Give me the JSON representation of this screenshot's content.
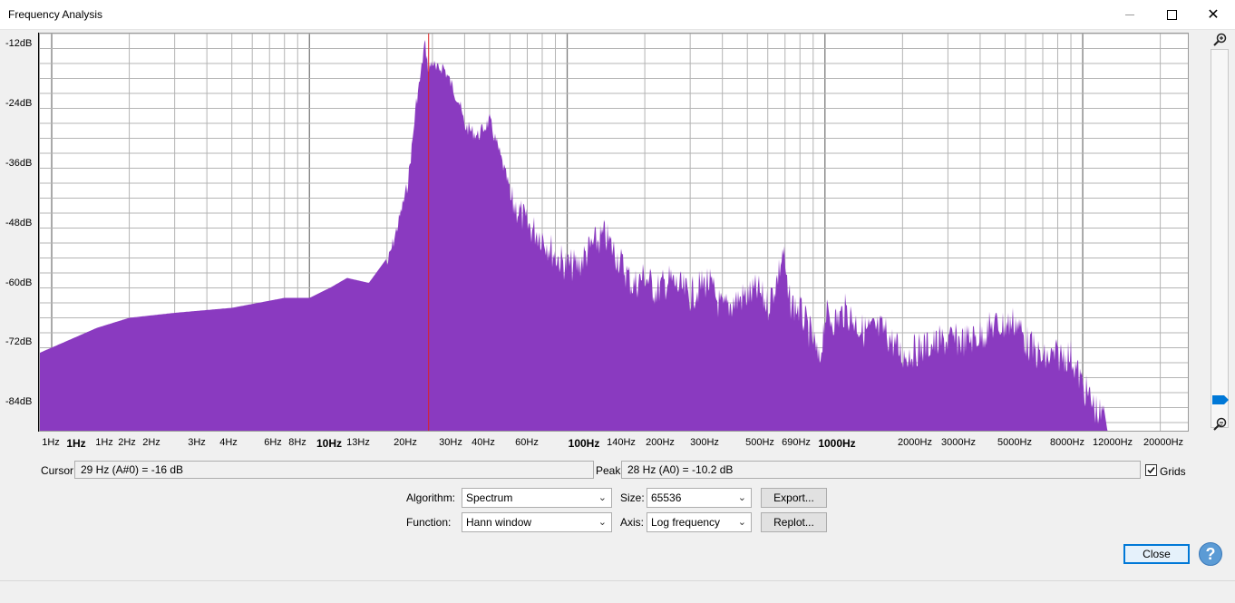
{
  "window": {
    "title": "Frequency Analysis",
    "minimize_glyph": "—",
    "close_glyph": "✕"
  },
  "graph": {
    "y_labels": [
      "-12dB",
      "-24dB",
      "-36dB",
      "-48dB",
      "-60dB",
      "-72dB",
      "-84dB"
    ],
    "x_labels": [
      {
        "text": "1Hz",
        "bold": false
      },
      {
        "text": "1Hz",
        "bold": true
      },
      {
        "text": "1Hz",
        "bold": false
      },
      {
        "text": "2Hz",
        "bold": false
      },
      {
        "text": "2Hz",
        "bold": false
      },
      {
        "text": "3Hz",
        "bold": false
      },
      {
        "text": "4Hz",
        "bold": false
      },
      {
        "text": "6Hz",
        "bold": false
      },
      {
        "text": "8Hz",
        "bold": false
      },
      {
        "text": "10Hz",
        "bold": true
      },
      {
        "text": "13Hz",
        "bold": false
      },
      {
        "text": "20Hz",
        "bold": false
      },
      {
        "text": "30Hz",
        "bold": false
      },
      {
        "text": "40Hz",
        "bold": false
      },
      {
        "text": "60Hz",
        "bold": false
      },
      {
        "text": "100Hz",
        "bold": true
      },
      {
        "text": "140Hz",
        "bold": false
      },
      {
        "text": "200Hz",
        "bold": false
      },
      {
        "text": "300Hz",
        "bold": false
      },
      {
        "text": "500Hz",
        "bold": false
      },
      {
        "text": "690Hz",
        "bold": false
      },
      {
        "text": "1000Hz",
        "bold": true
      },
      {
        "text": "2000Hz",
        "bold": false
      },
      {
        "text": "3000Hz",
        "bold": false
      },
      {
        "text": "5000Hz",
        "bold": false
      },
      {
        "text": "8000Hz",
        "bold": false
      },
      {
        "text": "12000Hz",
        "bold": false
      },
      {
        "text": "20000Hz",
        "bold": false
      }
    ],
    "fill_color": "#8a3ac0",
    "cursor_color": "#e02020",
    "grid_color": "#b4b4b4"
  },
  "chart_data": {
    "type": "area",
    "x_scale": "log",
    "x_unit": "Hz",
    "y_unit": "dB",
    "ylim": [
      -90,
      -10
    ],
    "xlim": [
      0.9,
      26000
    ],
    "grid": true,
    "cursor_hz": 29,
    "x": [
      0.9,
      1.5,
      2,
      3,
      5,
      8,
      10,
      12,
      14,
      17,
      20,
      22,
      24,
      25,
      26,
      27,
      28,
      29,
      30,
      31,
      33,
      35,
      38,
      40,
      45,
      50,
      55,
      60,
      65,
      70,
      80,
      90,
      100,
      110,
      125,
      140,
      160,
      180,
      200,
      220,
      250,
      300,
      350,
      400,
      450,
      500,
      550,
      600,
      650,
      690,
      720,
      800,
      900,
      950,
      1000,
      1100,
      1200,
      1400,
      1700,
      2000,
      2500,
      3000,
      3500,
      4000,
      4500,
      5000,
      5500,
      6000,
      7000,
      8000,
      9000,
      10000,
      11000,
      12000,
      12500,
      26000
    ],
    "y": [
      -74,
      -69,
      -67,
      -66,
      -65,
      -63,
      -63,
      -61,
      -59,
      -60,
      -55,
      -47,
      -39,
      -31,
      -22,
      -17,
      -10.2,
      -16,
      -14,
      -16,
      -15,
      -18,
      -22,
      -27,
      -29,
      -26,
      -33,
      -40,
      -42,
      -45,
      -47,
      -51,
      -53,
      -53,
      -49,
      -47,
      -52,
      -57,
      -55,
      -58,
      -56,
      -59,
      -56,
      -62,
      -60,
      -59,
      -58,
      -61,
      -56,
      -50,
      -60,
      -62,
      -68,
      -73,
      -63,
      -64,
      -62,
      -66,
      -66,
      -71,
      -69,
      -68,
      -68,
      -67,
      -65,
      -65,
      -64,
      -68,
      -72,
      -71,
      -71,
      -77,
      -81,
      -84,
      -90,
      -90
    ]
  },
  "readouts": {
    "cursor_label": "Cursor:",
    "cursor_value": "29 Hz (A#0) = -16 dB",
    "peak_label": "Peak:",
    "peak_value": "28 Hz (A0) = -10.2 dB",
    "grids_label": "Grids",
    "grids_checked": true
  },
  "controls": {
    "algorithm_label": "Algorithm:",
    "algorithm_value": "Spectrum",
    "function_label": "Function:",
    "function_value": "Hann window",
    "size_label": "Size:",
    "size_value": "65536",
    "axis_label": "Axis:",
    "axis_value": "Log frequency",
    "export_label": "Export...",
    "replot_label": "Replot...",
    "close_label": "Close",
    "help_glyph": "?"
  }
}
